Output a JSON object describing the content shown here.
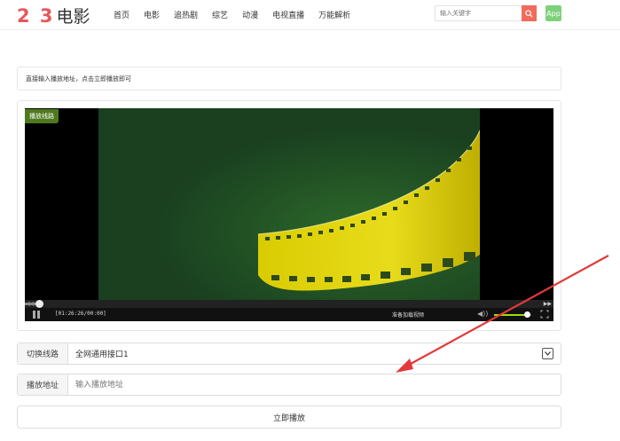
{
  "header": {
    "logo_num": "2 3",
    "logo_text": "电影",
    "nav": [
      "首页",
      "电影",
      "追热剧",
      "综艺",
      "动漫",
      "电视直播",
      "万能解析"
    ],
    "search_placeholder": "输入关键字",
    "app_label": "App",
    "colors": {
      "logo_num": "#e8585a",
      "search_button": "#f26a5b",
      "app_button": "#7ed17a"
    }
  },
  "notice": "直接输入播放地址，点击立即播放即可",
  "player": {
    "line_badge": "播放线路",
    "time": "[01:26:26/00:00]",
    "status": "准备加载视频",
    "volume": 0.88,
    "progress": 0.02
  },
  "form": {
    "line_label": "切换线路",
    "line_value": "全网通用接口1",
    "url_label": "播放地址",
    "url_placeholder": "输入播放地址",
    "play_button": "立即播放"
  },
  "icons": [
    "search-icon",
    "pause-icon",
    "volume-icon",
    "fullscreen-icon",
    "chevron-down-icon",
    "rewind-icon",
    "forward-icon"
  ]
}
